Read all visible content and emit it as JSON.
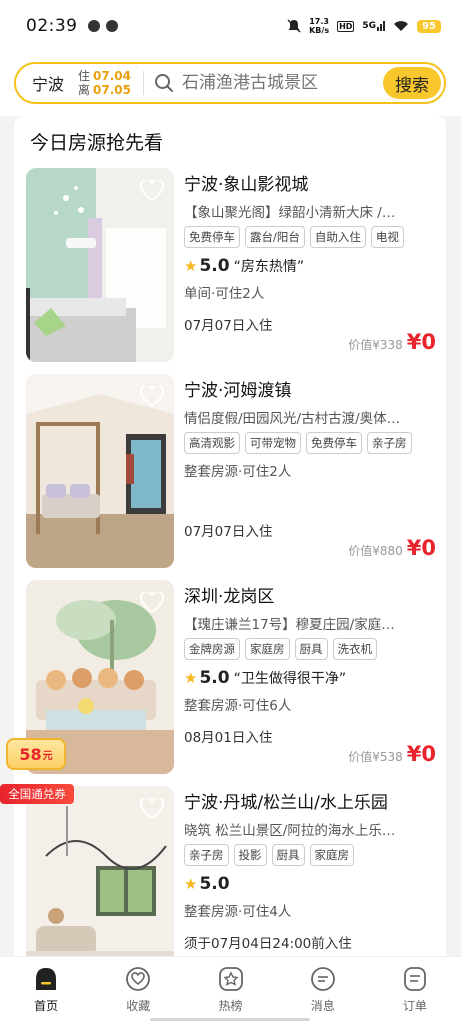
{
  "status_bar": {
    "time": "02:39",
    "net_speed_top": "17.3",
    "net_speed_unit": "KB/s",
    "hd": "HD",
    "signal": "5G",
    "battery": "95"
  },
  "search": {
    "city": "宁波",
    "checkin_label": "住",
    "checkin_date": "07.04",
    "checkout_label": "离",
    "checkout_date": "07.05",
    "placeholder": "石浦渔港古城景区",
    "button_label": "搜索"
  },
  "section_title": "今日房源抢先看",
  "listings": [
    {
      "title": "宁波·象山影视城",
      "desc": "【象山聚光阁】绿韶小清新大床 /…",
      "tags": [
        "免费停车",
        "露台/阳台",
        "自助入住",
        "电视"
      ],
      "score": "5.0",
      "review": "“房东热情”",
      "type": "单间·可住2人",
      "checkin": "07月07日入住",
      "orig_price": "价值¥338",
      "price": "¥0"
    },
    {
      "title": "宁波·河姆渡镇",
      "desc": "情侣度假/田园风光/古村古渡/奥体…",
      "tags": [
        "高清观影",
        "可带宠物",
        "免费停车",
        "亲子房"
      ],
      "score": "",
      "review": "",
      "type": "整套房源·可住2人",
      "checkin": "07月07日入住",
      "orig_price": "价值¥880",
      "price": "¥0"
    },
    {
      "title": "深圳·龙岗区",
      "desc": "【瑰庄谦兰17号】穆夏庄园/家庭…",
      "tags": [
        "金牌房源",
        "家庭房",
        "厨具",
        "洗衣机"
      ],
      "score": "5.0",
      "review": "“卫生做得很干净”",
      "type": "整套房源·可住6人",
      "checkin": "08月01日入住",
      "orig_price": "价值¥538",
      "price": "¥0"
    },
    {
      "title": "宁波·丹城/松兰山/水上乐园",
      "desc": "晓筑 松兰山景区/阿拉的海水上乐…",
      "tags": [
        "亲子房",
        "投影",
        "厨具",
        "家庭房"
      ],
      "score": "5.0",
      "review": "",
      "type": "整套房源·可住4人",
      "checkin": "须于07月04日24:00前入住",
      "orig_price": "",
      "price": ""
    }
  ],
  "coupon": {
    "amount": "58",
    "unit": "元",
    "label": "全国通兑券"
  },
  "tabs": [
    {
      "label": "首页",
      "icon": "home-icon",
      "active": true
    },
    {
      "label": "收藏",
      "icon": "heart-icon",
      "active": false
    },
    {
      "label": "热榜",
      "icon": "hot-list-icon",
      "active": false
    },
    {
      "label": "消息",
      "icon": "message-icon",
      "active": false
    },
    {
      "label": "订单",
      "icon": "order-icon",
      "active": false
    }
  ],
  "colors": {
    "accent_yellow": "#f7c72c",
    "price_red": "#e8242c",
    "date_orange": "#e8a10c"
  }
}
